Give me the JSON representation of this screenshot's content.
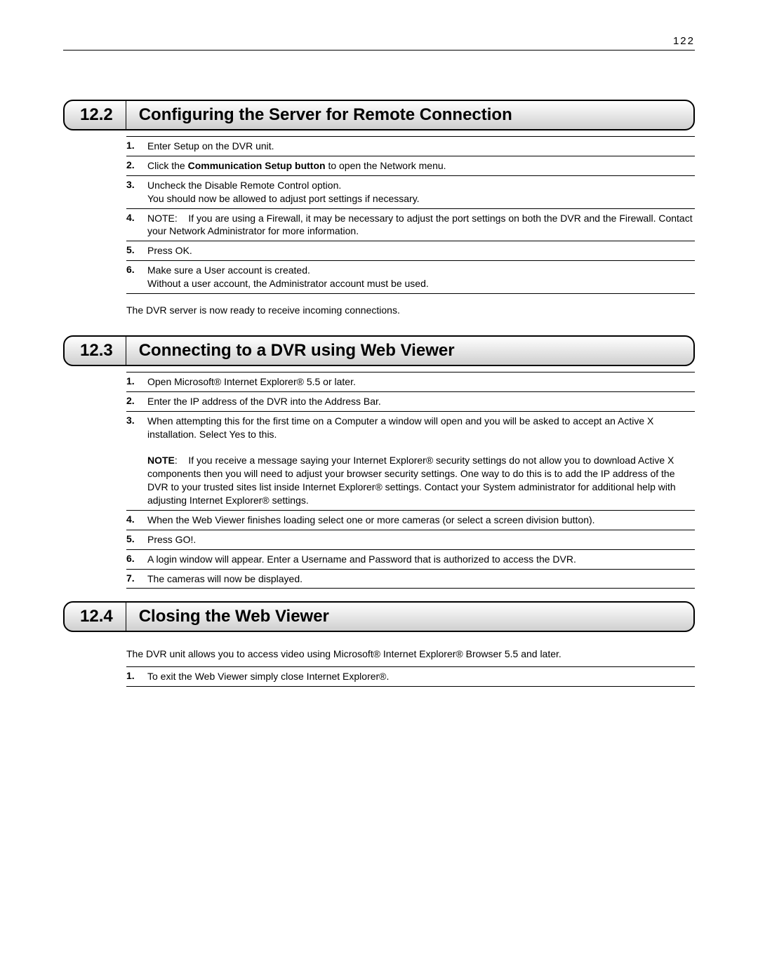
{
  "page_number": "122",
  "sections": [
    {
      "num": "12.2",
      "title": "Configuring the Server for Remote Connection",
      "intro": "",
      "steps": [
        {
          "n": "1.",
          "html": "Enter Setup on the DVR unit."
        },
        {
          "n": "2.",
          "html": "Click the <span class=\"bold\">Communication Setup button</span> to open the Network menu."
        },
        {
          "n": "3.",
          "html": "Uncheck the Disable Remote Control option.<br>You should now be allowed to adjust port settings if necessary."
        },
        {
          "n": "4.",
          "html": "NOTE:&nbsp;&nbsp;&nbsp;&nbsp;If you are using a Firewall, it may be necessary to adjust the port settings on both the DVR and the Firewall.  Contact your Network Administrator for more information."
        },
        {
          "n": "5.",
          "html": "Press OK."
        },
        {
          "n": "6.",
          "html": "Make sure a User account is created.<br>Without a user account, the Administrator account must be used."
        }
      ],
      "outro": "The DVR server is now ready to receive incoming connections."
    },
    {
      "num": "12.3",
      "title": "Connecting to a DVR using Web Viewer",
      "intro": "",
      "steps": [
        {
          "n": "1.",
          "html": "Open Microsoft® Internet Explorer® 5.5 or later."
        },
        {
          "n": "2.",
          "html": "Enter the IP address of the DVR into the Address Bar."
        },
        {
          "n": "3.",
          "html": "When attempting this for the first time on a Computer a window will open and you will be asked to accept an Active X installation. Select Yes to this.<br><br><span class=\"bold\">NOTE</span>:&nbsp;&nbsp;&nbsp;&nbsp;If you receive a message saying your Internet Explorer® security settings do not allow you to download Active X components then you will need to adjust your browser security settings. One way to do this is to add the IP address of the DVR to your trusted sites list inside Internet Explorer® settings. Contact your System administrator for additional help with adjusting Internet Explorer® settings."
        },
        {
          "n": "4.",
          "html": "When the Web Viewer finishes loading select one or more cameras (or select a screen division button)."
        },
        {
          "n": "5.",
          "html": "Press GO!."
        },
        {
          "n": "6.",
          "html": "A login window will appear. Enter a Username and Password that is authorized to access the DVR."
        },
        {
          "n": "7.",
          "html": "The cameras will now be displayed."
        }
      ],
      "outro": ""
    },
    {
      "num": "12.4",
      "title": "Closing the Web Viewer",
      "intro": "The DVR unit allows you to access video using Microsoft® Internet Explorer® Browser 5.5 and later.",
      "steps": [
        {
          "n": "1.",
          "html": "To exit the Web Viewer simply close Internet Explorer®."
        }
      ],
      "outro": ""
    }
  ]
}
